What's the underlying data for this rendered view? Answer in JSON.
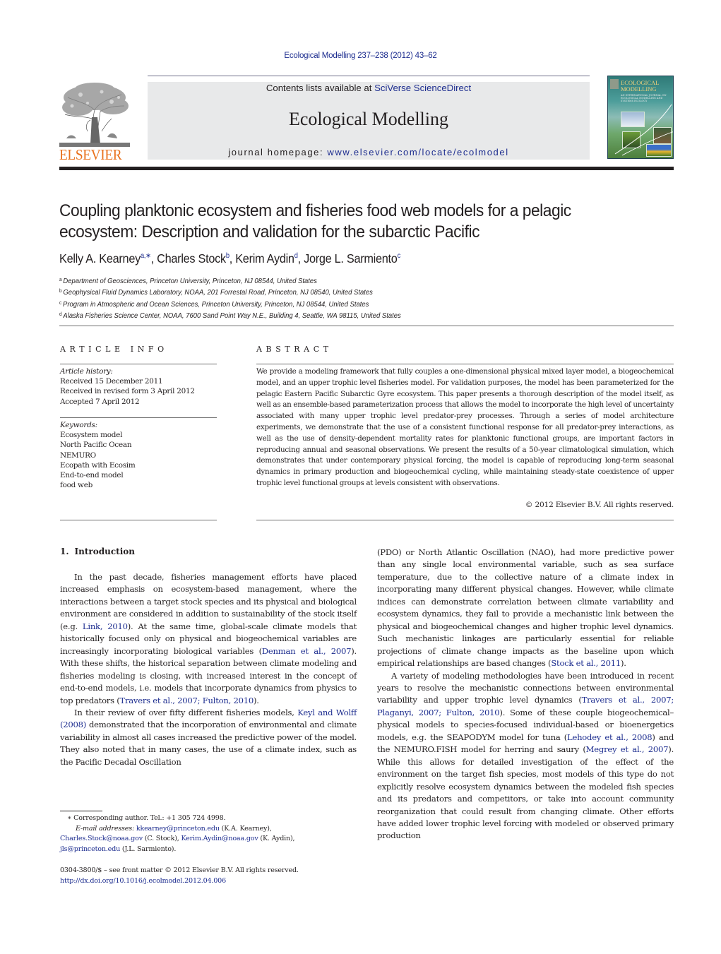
{
  "running_head": "Ecological Modelling 237–238 (2012) 43–62",
  "banner": {
    "contents_prefix": "Contents lists available at ",
    "contents_link": "SciVerse ScienceDirect",
    "journal_name": "Ecological Modelling",
    "homepage_prefix": "journal homepage: ",
    "homepage_link": "www.elsevier.com/locate/ecolmodel"
  },
  "publisher_logo": {
    "wordmark": "ELSEVIER",
    "icon": "elsevier-tree-icon"
  },
  "cover": {
    "title_line1": "ECOLOGICAL",
    "title_line2": "MODELLING",
    "subtitle": "AN INTERNATIONAL JOURNAL ON ECOLOGICAL MODELLING AND SYSTEMS ECOLOGY"
  },
  "colors": {
    "link": "#1d2d8f",
    "elsevier_orange": "#e9711c",
    "banner_bg": "#e8e9ea",
    "text": "#231f20"
  },
  "article": {
    "title_line1": "Coupling planktonic ecosystem and fisheries food web models for a pelagic",
    "title_line2": "ecosystem: Description and validation for the subarctic Pacific",
    "authors": [
      {
        "name": "Kelly A. Kearney",
        "sup": "a,∗",
        "sep": ", "
      },
      {
        "name": "Charles Stock",
        "sup": "b",
        "sep": ", "
      },
      {
        "name": "Kerim Aydin",
        "sup": "d",
        "sep": ", "
      },
      {
        "name": "Jorge L. Sarmiento",
        "sup": "c",
        "sep": ""
      }
    ],
    "affiliations": [
      {
        "mark": "a",
        "text": "Department of Geosciences, Princeton University, Princeton, NJ 08544, United States"
      },
      {
        "mark": "b",
        "text": "Geophysical Fluid Dynamics Laboratory, NOAA, 201 Forrestal Road, Princeton, NJ 08540, United States"
      },
      {
        "mark": "c",
        "text": "Program in Atmospheric and Ocean Sciences, Princeton University, Princeton, NJ 08544, United States"
      },
      {
        "mark": "d",
        "text": "Alaska Fisheries Science Center, NOAA, 7600 Sand Point Way N.E., Building 4, Seattle, WA 98115, United States"
      }
    ]
  },
  "article_info": {
    "heading": "ARTICLE INFO",
    "history_label": "Article history:",
    "history": [
      "Received 15 December 2011",
      "Received in revised form 3 April 2012",
      "Accepted 7 April 2012"
    ],
    "keywords_label": "Keywords:",
    "keywords": [
      "Ecosystem model",
      "North Pacific Ocean",
      "NEMURO",
      "Ecopath with Ecosim",
      "End-to-end model",
      "food web"
    ]
  },
  "abstract": {
    "heading": "ABSTRACT",
    "text": "We provide a modeling framework that fully couples a one-dimensional physical mixed layer model, a biogeochemical model, and an upper trophic level fisheries model. For validation purposes, the model has been parameterized for the pelagic Eastern Pacific Subarctic Gyre ecosystem. This paper presents a thorough description of the model itself, as well as an ensemble-based parameterization process that allows the model to incorporate the high level of uncertainty associated with many upper trophic level predator-prey processes. Through a series of model architecture experiments, we demonstrate that the use of a consistent functional response for all predator-prey interactions, as well as the use of density-dependent mortality rates for planktonic functional groups, are important factors in reproducing annual and seasonal observations. We present the results of a 50-year climatological simulation, which demonstrates that under contemporary physical forcing, the model is capable of reproducing long-term seasonal dynamics in primary production and biogeochemical cycling, while maintaining steady-state coexistence of upper trophic level functional groups at levels consistent with observations.",
    "copyright": "© 2012 Elsevier B.V. All rights reserved."
  },
  "body": {
    "section_number": "1.",
    "section_title": "Introduction",
    "left_p1": [
      {
        "t": "In the past decade, fisheries management efforts have placed increased emphasis on ecosystem-based management, where the interactions between a target stock species and its physical and biological environment are considered in addition to sustainability of the stock itself (e.g. "
      },
      {
        "link": "Link, 2010"
      },
      {
        "t": "). At the same time, global-scale climate models that historically focused only on physical and biogeochemical variables are increasingly incorporating biological variables ("
      },
      {
        "link": "Denman et al., 2007"
      },
      {
        "t": "). With these shifts, the historical separation between climate modeling and fisheries modeling is closing, with increased interest in the concept of end-to-end models, i.e. models that incorporate dynamics from physics to top predators ("
      },
      {
        "link": "Travers et al., 2007; Fulton, 2010"
      },
      {
        "t": ")."
      }
    ],
    "left_p2": [
      {
        "t": "In their review of over fifty different fisheries models, "
      },
      {
        "link": "Keyl and Wolff (2008)"
      },
      {
        "t": " demonstrated that the incorporation of environmental and climate variability in almost all cases increased the predictive power of the model. They also noted that in many cases, the use of a climate index, such as the Pacific Decadal Oscillation"
      }
    ],
    "right_p1": [
      {
        "t": "(PDO) or North Atlantic Oscillation (NAO), had more predictive power than any single local environmental variable, such as sea surface temperature, due to the collective nature of a climate index in incorporating many different physical changes. However, while climate indices can demonstrate correlation between climate variability and ecosystem dynamics, they fail to provide a mechanistic link between the physical and biogeochemical changes and higher trophic level dynamics. Such mechanistic linkages are particularly essential for reliable projections of climate change impacts as the baseline upon which empirical relationships are based changes ("
      },
      {
        "link": "Stock et al., 2011"
      },
      {
        "t": ")."
      }
    ],
    "right_p2": [
      {
        "t": "A variety of modeling methodologies have been introduced in recent years to resolve the mechanistic connections between environmental variability and upper trophic level dynamics ("
      },
      {
        "link": "Travers et al., 2007; Plaganyi, 2007; Fulton, 2010"
      },
      {
        "t": "). Some of these couple biogeochemical–physical models to species-focused individual-based or bioenergetics models, e.g. the SEAPODYM model for tuna ("
      },
      {
        "link": "Lehodey et al., 2008"
      },
      {
        "t": ") and the NEMURO.FISH model for herring and saury ("
      },
      {
        "link": "Megrey et al., 2007"
      },
      {
        "t": "). While this allows for detailed investigation of the effect of the environment on the target fish species, most models of this type do not explicitly resolve ecosystem dynamics between the modeled fish species and its predators and competitors, or take into account community reorganization that could result from changing climate. Other efforts have added lower trophic level forcing with modeled or observed primary production"
      }
    ]
  },
  "footnotes": {
    "corresponding": "∗ Corresponding author. Tel.: +1 305 724 4998.",
    "email_label": "E-mail addresses:",
    "emails": [
      {
        "addr": "kkearney@princeton.edu",
        "who": " (K.A. Kearney),"
      },
      {
        "addr": "Charles.Stock@noaa.gov",
        "who": " (C. Stock), "
      },
      {
        "addr": "Kerim.Aydin@noaa.gov",
        "who": " (K. Aydin),"
      },
      {
        "addr": "jls@princeton.edu",
        "who": " (J.L. Sarmiento)."
      }
    ],
    "front_matter": "0304-3800/$ – see front matter © 2012 Elsevier B.V. All rights reserved.",
    "doi": "http://dx.doi.org/10.1016/j.ecolmodel.2012.04.006"
  }
}
